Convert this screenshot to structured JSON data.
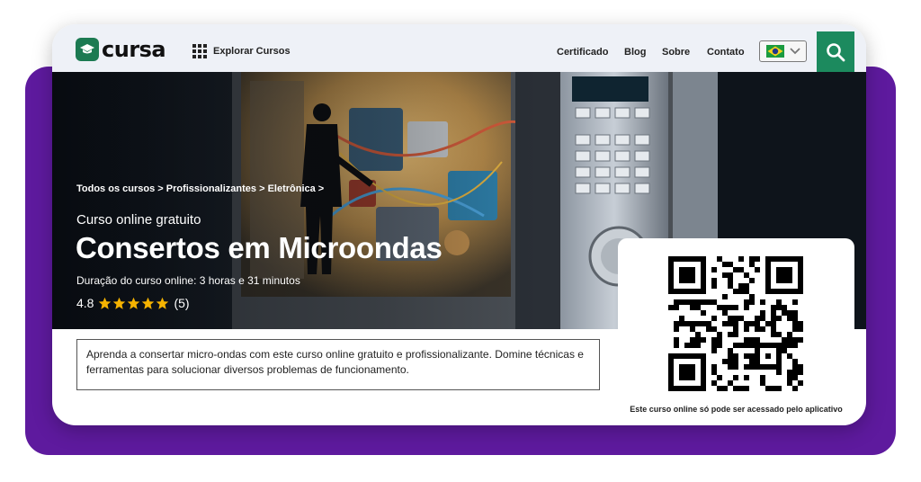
{
  "brand": {
    "name": "cursa",
    "accent": "#1c8a5e",
    "purple": "#5e1a9e"
  },
  "header": {
    "explore_label": "Explorar Cursos",
    "nav": [
      "Certificado",
      "Blog",
      "Sobre",
      "Contato"
    ],
    "language_icon": "brazil-flag-icon",
    "search_icon": "search-icon"
  },
  "hero": {
    "breadcrumb": [
      "Todos os cursos",
      "Profissionalizantes",
      "Eletrônica"
    ],
    "subtitle": "Curso online gratuito",
    "title": "Consertos em Microondas",
    "duration": "Duração do curso online: 3 horas e 31 minutos",
    "rating": {
      "value": "4.8",
      "stars": 5,
      "count": "(5)"
    }
  },
  "description": "Aprenda a consertar micro-ondas com este curso online gratuito e profissionalizante. Domine técnicas e ferramentas para solucionar diversos problemas de funcionamento.",
  "qr": {
    "caption": "Este curso online só pode ser acessado pelo aplicativo"
  }
}
